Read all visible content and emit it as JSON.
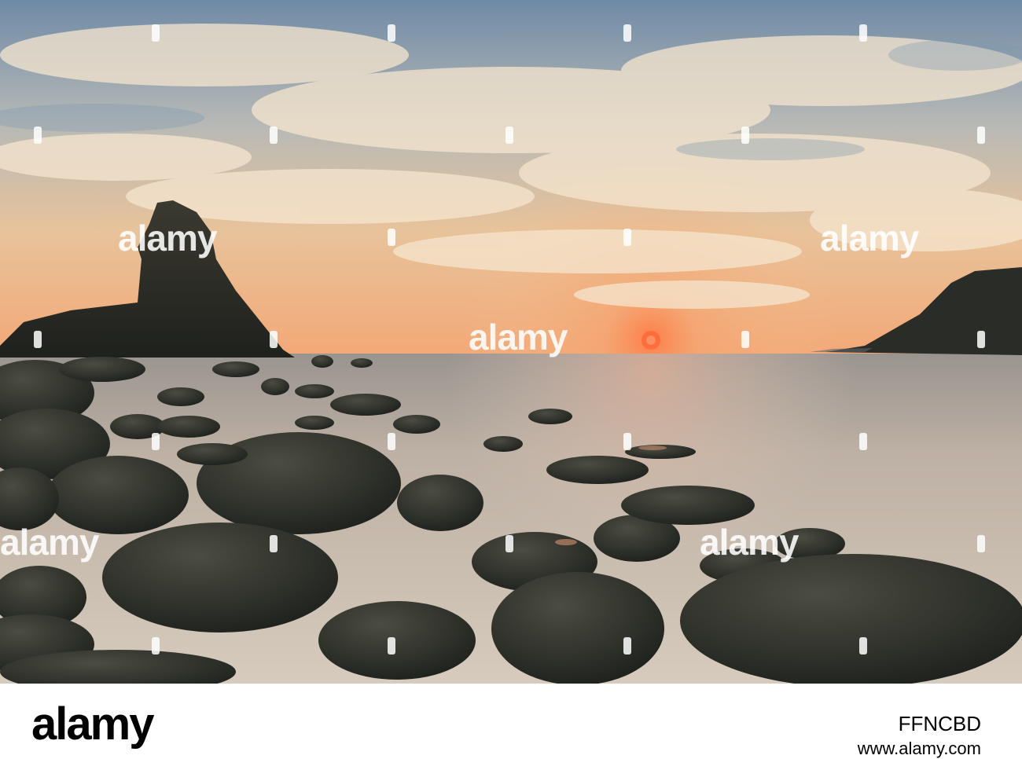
{
  "watermark": {
    "logo_text": "alamy"
  },
  "footer": {
    "logo_text": "alamy",
    "image_id": "FFNCBD",
    "url": "www.alamy.com"
  },
  "colors": {
    "sky_top": "#6c89a8",
    "sky_glow": "#f2c79a",
    "sun": "#ff5a2e",
    "sea": "#c9bcad",
    "rock": "#2c2e27"
  }
}
